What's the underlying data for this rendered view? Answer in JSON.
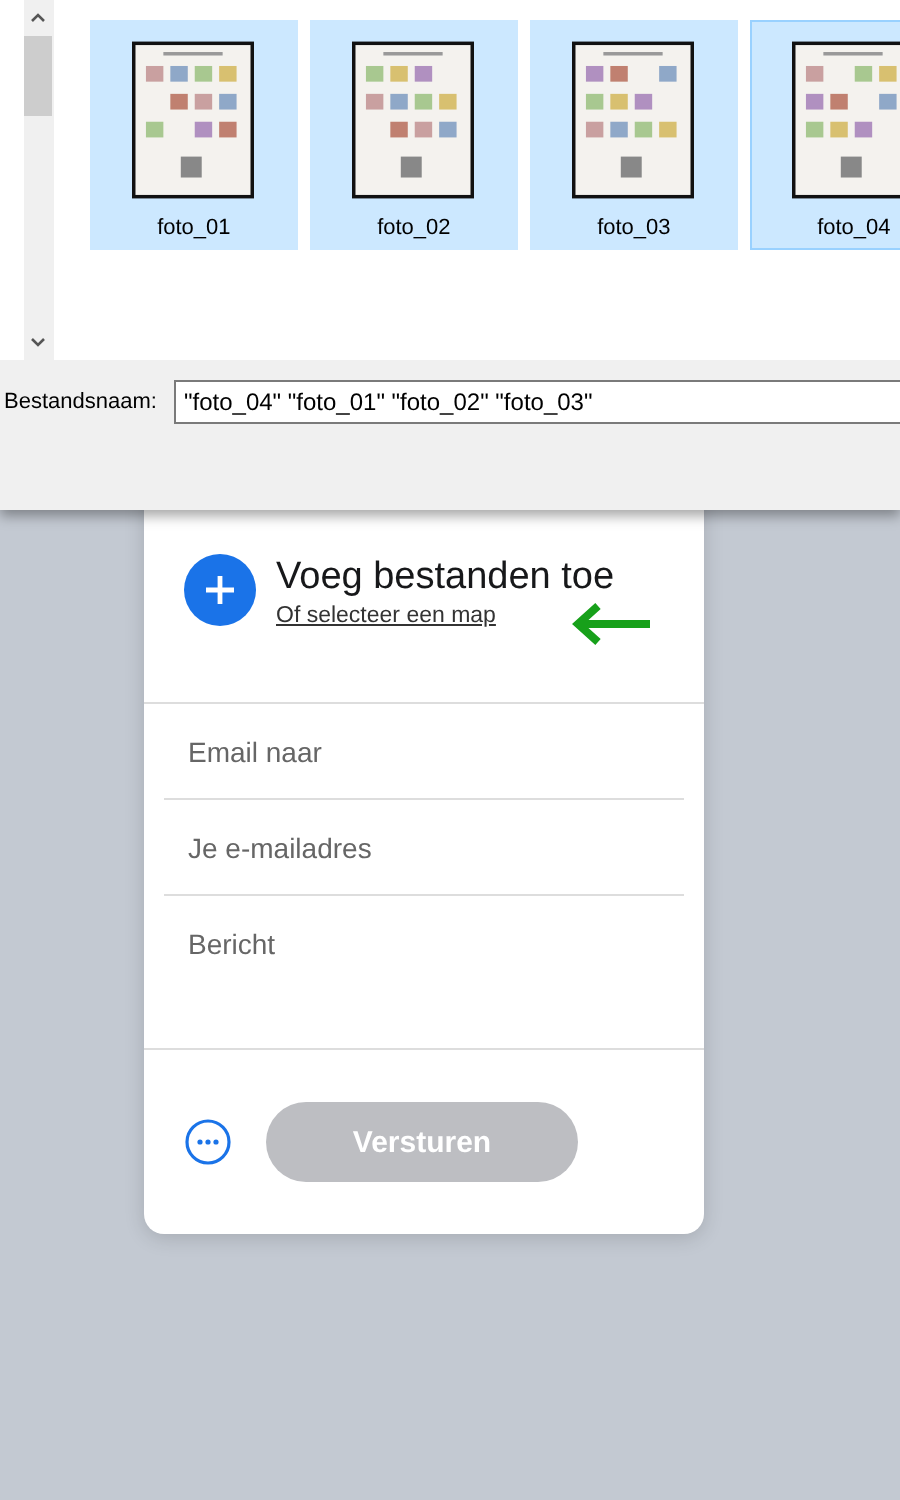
{
  "file_dialog": {
    "thumbnails": [
      {
        "label": "foto_01",
        "selected": true,
        "focused": false
      },
      {
        "label": "foto_02",
        "selected": true,
        "focused": false
      },
      {
        "label": "foto_03",
        "selected": true,
        "focused": false
      },
      {
        "label": "foto_04",
        "selected": true,
        "focused": true
      }
    ],
    "filename_label": "Bestandsnaam:",
    "filename_value": "\"foto_04\" \"foto_01\" \"foto_02\" \"foto_03\""
  },
  "upload_card": {
    "title": "Voeg bestanden toe",
    "link": "Of selecteer een map",
    "fields": [
      {
        "placeholder": "Email naar",
        "kind": "line"
      },
      {
        "placeholder": "Je e-mailadres",
        "kind": "line"
      },
      {
        "placeholder": "Bericht",
        "kind": "area"
      }
    ],
    "send_button": {
      "label": "Versturen",
      "disabled": true
    }
  }
}
